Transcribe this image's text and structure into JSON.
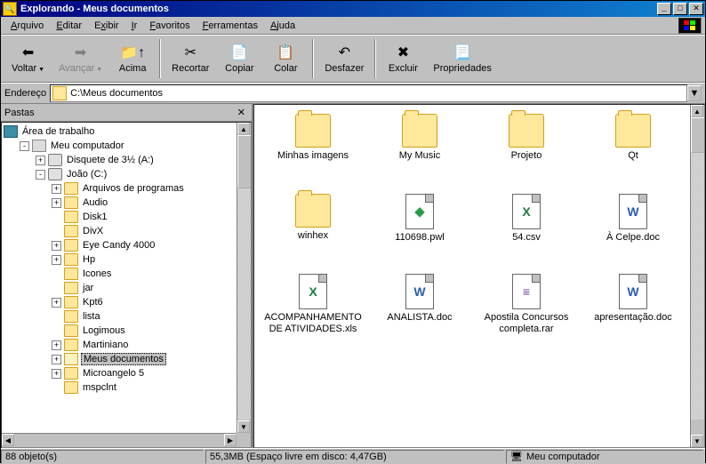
{
  "window": {
    "title": "Explorando - Meus documentos"
  },
  "menu": {
    "items": [
      {
        "label": "Arquivo",
        "accel": "A"
      },
      {
        "label": "Editar",
        "accel": "E"
      },
      {
        "label": "Exibir",
        "accel": "x"
      },
      {
        "label": "Ir",
        "accel": "I"
      },
      {
        "label": "Favoritos",
        "accel": "F"
      },
      {
        "label": "Ferramentas",
        "accel": "F"
      },
      {
        "label": "Ajuda",
        "accel": "A"
      }
    ]
  },
  "toolbar": {
    "back": "Voltar",
    "forward": "Avançar",
    "up": "Acima",
    "cut": "Recortar",
    "copy": "Copiar",
    "paste": "Colar",
    "undo": "Desfazer",
    "delete": "Excluir",
    "properties": "Propriedades"
  },
  "address": {
    "label": "Endereço",
    "value": "C:\\Meus documentos"
  },
  "tree": {
    "header": "Pastas",
    "root": "Área de trabalho",
    "nodes": [
      {
        "depth": 1,
        "label": "Meu computador",
        "icon": "computer",
        "exp": "-"
      },
      {
        "depth": 2,
        "label": "Disquete de 3½ (A:)",
        "icon": "drive",
        "exp": "+"
      },
      {
        "depth": 2,
        "label": "João (C:)",
        "icon": "drive",
        "exp": "-"
      },
      {
        "depth": 3,
        "label": "Arquivos de programas",
        "icon": "folder",
        "exp": "+"
      },
      {
        "depth": 3,
        "label": "Audio",
        "icon": "folder",
        "exp": "+"
      },
      {
        "depth": 3,
        "label": "Disk1",
        "icon": "folder",
        "exp": ""
      },
      {
        "depth": 3,
        "label": "DivX",
        "icon": "folder",
        "exp": ""
      },
      {
        "depth": 3,
        "label": "Eye Candy 4000",
        "icon": "folder",
        "exp": "+"
      },
      {
        "depth": 3,
        "label": "Hp",
        "icon": "folder",
        "exp": "+"
      },
      {
        "depth": 3,
        "label": "Icones",
        "icon": "folder",
        "exp": ""
      },
      {
        "depth": 3,
        "label": "jar",
        "icon": "folder",
        "exp": ""
      },
      {
        "depth": 3,
        "label": "Kpt6",
        "icon": "folder",
        "exp": "+"
      },
      {
        "depth": 3,
        "label": "lista",
        "icon": "folder",
        "exp": ""
      },
      {
        "depth": 3,
        "label": "Logimous",
        "icon": "folder",
        "exp": ""
      },
      {
        "depth": 3,
        "label": "Martiniano",
        "icon": "folder",
        "exp": "+"
      },
      {
        "depth": 3,
        "label": "Meus documentos",
        "icon": "folder-open",
        "exp": "+",
        "selected": true
      },
      {
        "depth": 3,
        "label": "Microangelo 5",
        "icon": "folder",
        "exp": "+"
      },
      {
        "depth": 3,
        "label": "mspclnt",
        "icon": "folder",
        "exp": ""
      }
    ]
  },
  "files": [
    {
      "name": "Minhas imagens",
      "type": "folder"
    },
    {
      "name": "My Music",
      "type": "folder"
    },
    {
      "name": "Projeto",
      "type": "folder"
    },
    {
      "name": "Qt",
      "type": "folder"
    },
    {
      "name": "winhex",
      "type": "folder"
    },
    {
      "name": "110698.pwl",
      "type": "pwl"
    },
    {
      "name": "54.csv",
      "type": "xls"
    },
    {
      "name": "À Celpe.doc",
      "type": "doc"
    },
    {
      "name": "ACOMPANHAMENTO DE ATIVIDADES.xls",
      "type": "xls"
    },
    {
      "name": "ANALISTA.doc",
      "type": "doc"
    },
    {
      "name": "Apostila Concursos completa.rar",
      "type": "rar"
    },
    {
      "name": "apresentação.doc",
      "type": "doc"
    }
  ],
  "status": {
    "count": "88 objeto(s)",
    "size": "55,3MB (Espaço livre em disco: 4,47GB)",
    "location": "Meu computador"
  }
}
